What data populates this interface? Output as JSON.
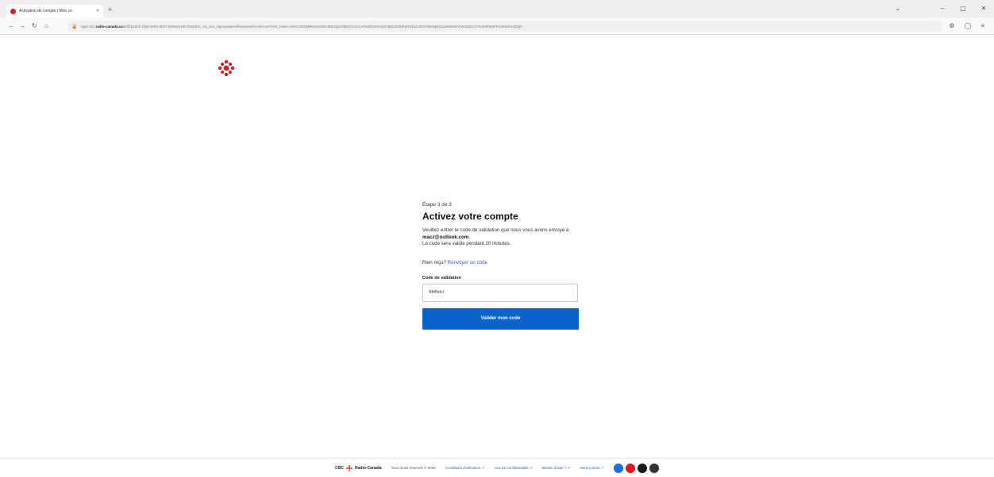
{
  "browser": {
    "tab_title": "Activation de compte | Mon co",
    "tab_close": "×",
    "new_tab": "+",
    "url_prefix": "login.cbc.",
    "url_domain": "radio-canada.ca",
    "url_rest": "/te/f1b32bb-f1b0-4260-9b27-b09e2e19b7b94/b2c_1a_sso_signup/api/selfasserted/confirmed?csrf_token=bVcHJhZQMExeU8sNnlBb3ZpU09EZzU4UUVhakh0ZmVjQm9Eb3Z3bFpRd3hZUWJHbE9qN2t1aW9tdmhYdzZ6b0xVVkZHRWdFbVd3aHNvQ0pK",
    "lock_icon": "lock-icon",
    "nav_icons": [
      "back-icon",
      "forward-icon",
      "reload-icon",
      "home-icon"
    ],
    "right_icons": [
      "extensions-icon",
      "account-icon",
      "downloads-icon",
      "menu-icon"
    ],
    "window_controls": [
      "⌄",
      "–",
      "▢",
      "✕"
    ]
  },
  "page": {
    "step": "Étape 3 de 3",
    "title": "Activez votre compte",
    "description_prefix": "Veuillez entrer le code de validation que nous vous avons envoyé à ",
    "email": "macz@outlook.com",
    "description_suffix": ".",
    "validity": "Le code sera valide pendant 20 minutes.",
    "resend_question": "Rien reçu? ",
    "resend_link": "Renvoyer un code",
    "code_label": "Code de validation",
    "code_value": "964557",
    "submit_label": "Valider mon code"
  },
  "footer": {
    "brand_cbc": "CBC",
    "brand_rc": "Radio-Canada",
    "copyright": "Tous droits réservés © 2025",
    "links": [
      "Conditions d'utilisation ↗",
      "Avis de confidentialité ↗",
      "Besoin d'aide ? ↗",
      "Nous joindre ↗"
    ],
    "social": [
      {
        "name": "social-icon-1",
        "color": "#1d6ee6"
      },
      {
        "name": "social-icon-2",
        "color": "#e3161d"
      },
      {
        "name": "social-icon-3",
        "color": "#1b1b1b"
      },
      {
        "name": "social-icon-4",
        "color": "#333333"
      }
    ]
  },
  "colors": {
    "accent": "#0a63c9",
    "brand_red": "#e3161d",
    "link": "#2a5fc2"
  }
}
